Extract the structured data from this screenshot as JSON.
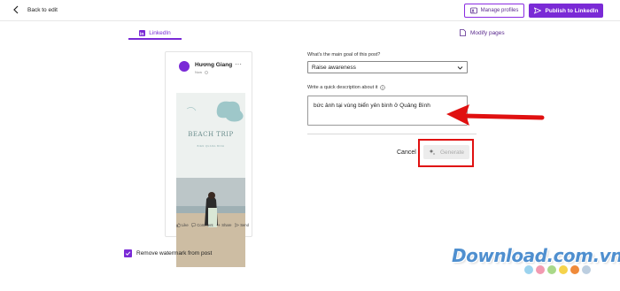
{
  "header": {
    "back_label": "Back to edit",
    "manage_profiles_label": "Manage profiles",
    "publish_label": "Publish to LinkedIn"
  },
  "tabs": {
    "linkedin_label": "LinkedIn",
    "modify_pages_label": "Modify pages"
  },
  "preview": {
    "author": "Hương Giang",
    "author_sub": "Now",
    "image_title": "BEACH TRIP",
    "image_subtitle": "BIEN QUANG BINH",
    "actions": [
      "Like",
      "Comment",
      "Share",
      "Send"
    ]
  },
  "watermark_option": {
    "label": "Remove watermark from post",
    "checked": true
  },
  "form": {
    "goal_question": "What's the main goal of this post?",
    "goal_value": "Raise awareness",
    "description_question": "Write a quick description about it",
    "description_value": "bức ảnh tại vùng biển yên bình ở Quảng Bình",
    "cancel_label": "Cancel",
    "generate_label": "Generate"
  },
  "branding": {
    "watermark_text": "Download.com.vn"
  },
  "colors": {
    "accent": "#7a2ad6",
    "annotation": "#e01010",
    "dots": [
      "#9bd3ee",
      "#f29ab1",
      "#a9d889",
      "#f5d34c",
      "#ef8a3a",
      "#bccee0"
    ]
  },
  "icons": [
    "chevron-left-icon",
    "profiles-icon",
    "send-icon",
    "linkedin-icon",
    "pages-icon",
    "more-icon",
    "globe-icon",
    "chevron-down-icon",
    "info-icon",
    "sparkle-icon",
    "like-icon",
    "comment-icon",
    "share-icon",
    "send-icon",
    "check-icon"
  ]
}
